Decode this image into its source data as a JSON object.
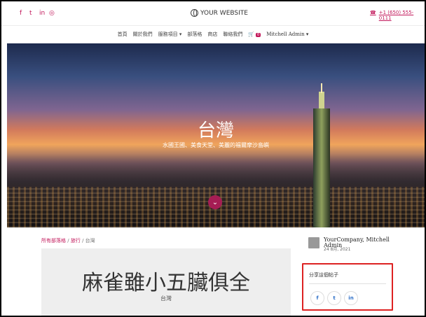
{
  "header": {
    "brand": "YOUR WEBSITE",
    "phone": "+1 (650) 555-0111",
    "social_icons": [
      "facebook-icon",
      "twitter-icon",
      "linkedin-icon",
      "instagram-icon"
    ]
  },
  "nav": {
    "items": [
      "首頁",
      "關於我們",
      "服務項目",
      "部落格",
      "商店",
      "聯絡我們"
    ],
    "cart_count": "0",
    "user": "Mitchell Admin"
  },
  "hero": {
    "title": "台灣",
    "subtitle": "水國王國、美食天堂、美麗的福爾摩沙島嶼",
    "scroll_icon": "chevron-down-icon"
  },
  "breadcrumb": {
    "all_blogs": "所有部落格",
    "travel": "旅行",
    "current": "台灣"
  },
  "post": {
    "title": "麻雀雖小五臟俱全",
    "category": "台灣"
  },
  "author": {
    "name": "YourCompany, Mitchell Admin",
    "date": "24 8月, 2021"
  },
  "share": {
    "title": "分享這個帖子",
    "buttons": [
      "facebook-icon",
      "twitter-icon",
      "linkedin-icon"
    ]
  },
  "colors": {
    "accent": "#c2185b",
    "share_highlight": "#dd2222"
  }
}
